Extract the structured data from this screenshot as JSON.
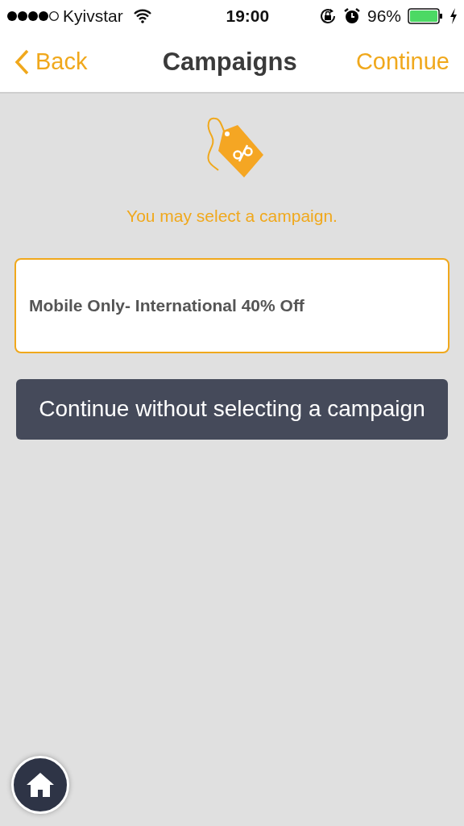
{
  "status_bar": {
    "carrier": "Kyivstar",
    "time": "19:00",
    "battery": "96%"
  },
  "nav": {
    "back": "Back",
    "title": "Campaigns",
    "action": "Continue"
  },
  "prompt": "You may select a campaign.",
  "campaigns": [
    {
      "name": "Mobile Only- International 40% Off"
    }
  ],
  "skip_button": "Continue without selecting a campaign"
}
